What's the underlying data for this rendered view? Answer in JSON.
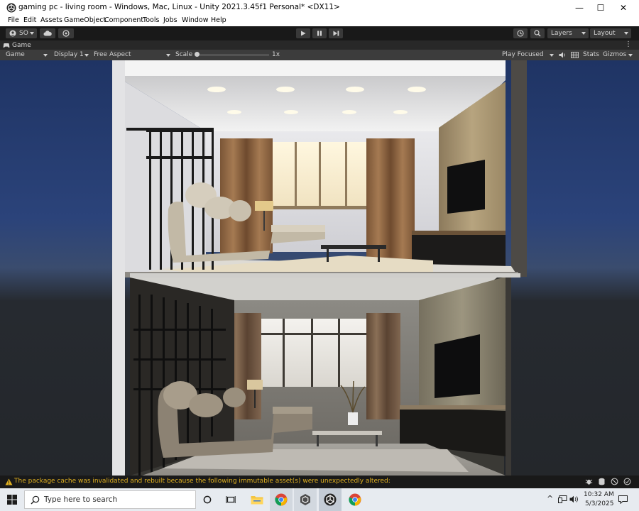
{
  "window": {
    "title": "gaming pc - living room - Windows, Mac, Linux - Unity 2021.3.45f1 Personal* <DX11>",
    "buttons": [
      "—",
      "☐",
      "✕"
    ]
  },
  "menu": [
    "File",
    "Edit",
    "Assets",
    "GameObject",
    "Component",
    "Tools",
    "Jobs",
    "Window",
    "Help"
  ],
  "toolbar": {
    "account_label": "SO",
    "layers_label": "Layers",
    "layout_label": "Layout"
  },
  "tab": {
    "label": "Game"
  },
  "gamebar": {
    "game_label": "Game",
    "display_label": "Display 1",
    "aspect_label": "Free Aspect",
    "scale_label": "Scale",
    "scale_value": "1x",
    "scale_fraction": 0.0,
    "play_focused_label": "Play Focused",
    "stats_label": "Stats",
    "gizmos_label": "Gizmos"
  },
  "console": {
    "message": "The package cache was invalidated and rebuilt because the following immutable asset(s) were unexpectedly altered:"
  },
  "taskbar": {
    "search_placeholder": "Type here to search",
    "time": "10:32 AM",
    "date": "5/3/2025"
  },
  "colors": {
    "accent_warning": "#e0b020",
    "toolbar_bg": "#191919",
    "panel_bg": "#282828",
    "taskbar_bg": "#e7ebf0"
  }
}
